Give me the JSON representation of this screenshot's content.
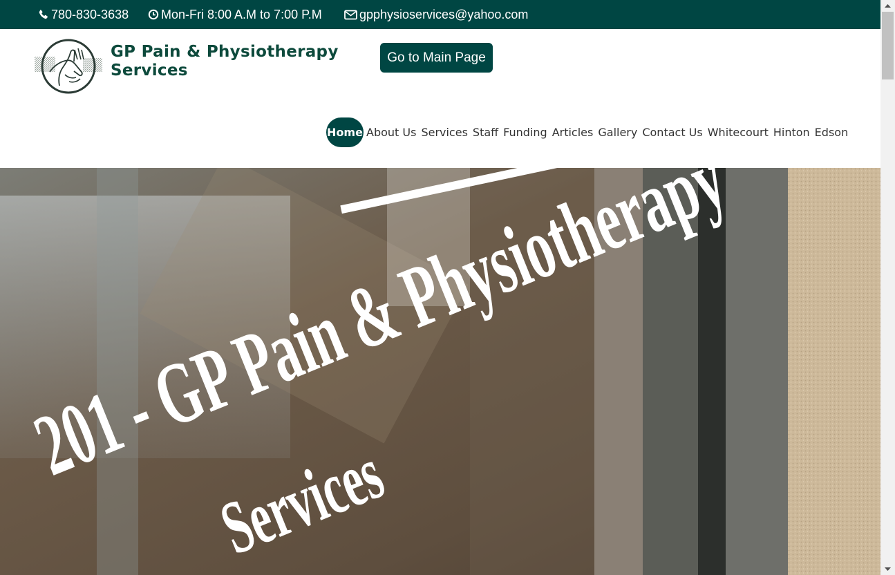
{
  "topbar": {
    "phone": "780-830-3638",
    "phone_icon": "phone-icon",
    "hours": "Mon-Fri 8:00 A.M to 7:00 P.M",
    "hours_icon": "clock-icon",
    "email": "gpphysioservices@yahoo.com",
    "email_icon": "envelope-icon",
    "background_color": "#004643"
  },
  "header": {
    "logo_line1": "GP Pain & Physiotherapy",
    "logo_line2": "Services",
    "logo_icon": "hands-logo-icon",
    "main_page_button": "Go to Main Page"
  },
  "nav": {
    "items": [
      {
        "label": "Home",
        "active": true
      },
      {
        "label": "About Us"
      },
      {
        "label": "Services"
      },
      {
        "label": "Staff"
      },
      {
        "label": "Funding"
      },
      {
        "label": "Articles"
      },
      {
        "label": "Gallery"
      },
      {
        "label": "Contact Us"
      },
      {
        "label": "Whitecourt"
      },
      {
        "label": "Hinton"
      },
      {
        "label": "Edson"
      }
    ]
  },
  "hero": {
    "sign_line1": "201 - GP Pain & Physiotherapy",
    "sign_line2": "Services"
  },
  "colors": {
    "brand": "#004643",
    "logo_text": "#0d4a3c"
  }
}
